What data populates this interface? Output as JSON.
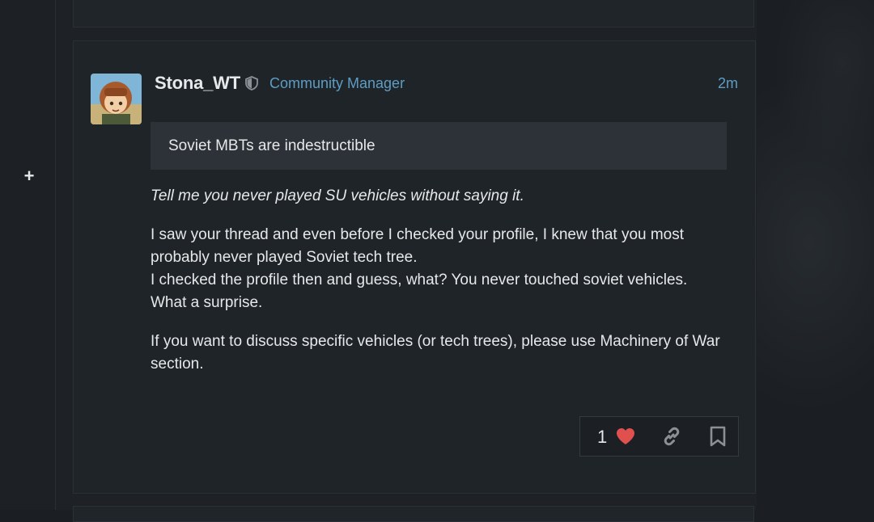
{
  "post": {
    "username": "Stona_WT",
    "user_title": "Community Manager",
    "time": "2m",
    "quote": "Soviet MBTs are indestructible",
    "paragraphs": {
      "p1": "Tell me you never played SU vehicles without saying it.",
      "p2_line1": "I saw your thread and even before I checked your profile, I knew that you most probably never played Soviet tech tree.",
      "p2_line2": "I checked the profile then and guess, what? You never touched soviet vehicles. What a surprise.",
      "p3": "If you want to discuss specific vehicles (or tech trees), please use Machinery of War section."
    },
    "likes": "1"
  },
  "sidebar": {
    "expand_label": "+"
  },
  "icons": {
    "shield": "shield-icon",
    "heart": "heart-icon",
    "link": "link-icon",
    "bookmark": "bookmark-icon"
  },
  "colors": {
    "background": "#1b1f23",
    "accent": "#5d9dc4",
    "like": "#e0504e",
    "quote_bg": "#2c3238"
  }
}
